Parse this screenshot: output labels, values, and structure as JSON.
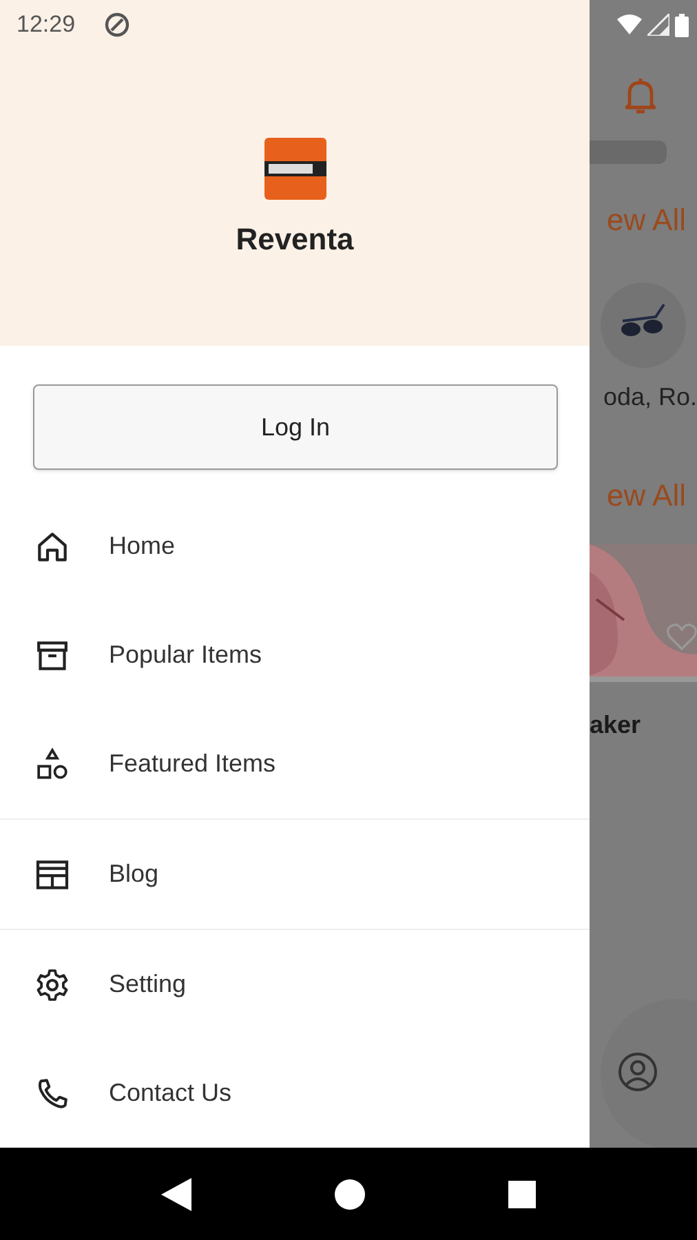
{
  "status_bar": {
    "time": "12:29"
  },
  "drawer": {
    "app_name": "Reventa",
    "login_button": "Log In",
    "sections": [
      {
        "items": [
          {
            "label": "Home",
            "kind": "home"
          },
          {
            "label": "Popular Items",
            "kind": "archive"
          },
          {
            "label": "Featured Items",
            "kind": "shapes"
          }
        ]
      },
      {
        "items": [
          {
            "label": "Blog",
            "kind": "blog"
          }
        ]
      },
      {
        "items": [
          {
            "label": "Setting",
            "kind": "gear"
          },
          {
            "label": "Contact Us",
            "kind": "phone"
          }
        ]
      }
    ]
  },
  "background": {
    "link_1": "ew All",
    "category_label": "oda, Ro.",
    "link_2": "ew All",
    "product_name": "aker"
  }
}
